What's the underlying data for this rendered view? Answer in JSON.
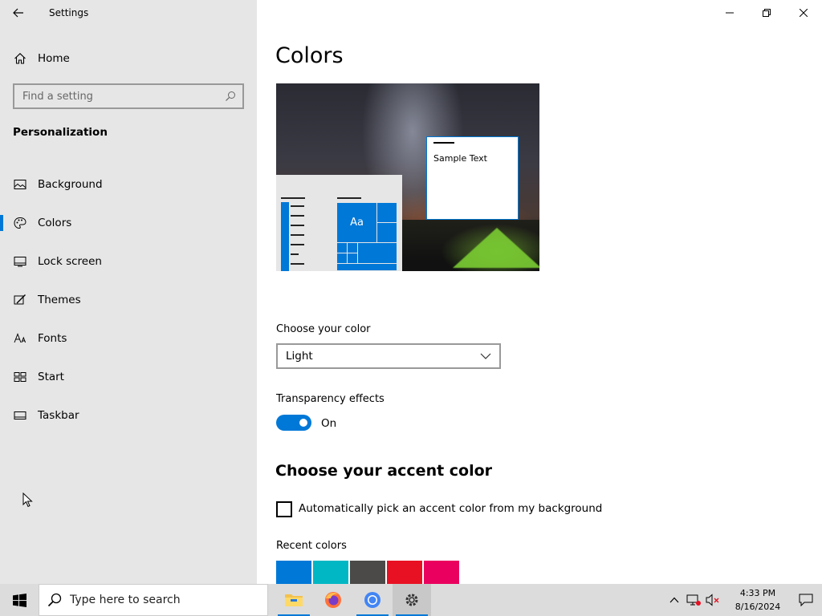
{
  "window": {
    "title": "Settings"
  },
  "sidebar": {
    "home_label": "Home",
    "search_placeholder": "Find a setting",
    "section_title": "Personalization",
    "items": [
      {
        "label": "Background",
        "icon": "picture-icon"
      },
      {
        "label": "Colors",
        "icon": "palette-icon",
        "selected": true
      },
      {
        "label": "Lock screen",
        "icon": "lock-screen-icon"
      },
      {
        "label": "Themes",
        "icon": "themes-icon"
      },
      {
        "label": "Fonts",
        "icon": "fonts-icon"
      },
      {
        "label": "Start",
        "icon": "start-icon"
      },
      {
        "label": "Taskbar",
        "icon": "taskbar-icon"
      }
    ]
  },
  "main": {
    "title": "Colors",
    "preview": {
      "sample_text": "Sample Text",
      "tile_text": "Aa"
    },
    "choose_color_label": "Choose your color",
    "choose_color_value": "Light",
    "transparency_label": "Transparency effects",
    "transparency_state": "On",
    "accent_heading": "Choose your accent color",
    "auto_accent_label": "Automatically pick an accent color from my background",
    "recent_colors_label": "Recent colors",
    "recent_colors": [
      "#0078d7",
      "#00b7c3",
      "#4c4a48",
      "#e81123",
      "#ea005e"
    ],
    "accent_color": "#0078d7"
  },
  "taskbar": {
    "search_placeholder": "Type here to search",
    "apps": [
      "file-explorer-icon",
      "firefox-icon",
      "chrome-icon",
      "settings-icon"
    ],
    "time": "4:33 PM",
    "date": "8/16/2024"
  }
}
